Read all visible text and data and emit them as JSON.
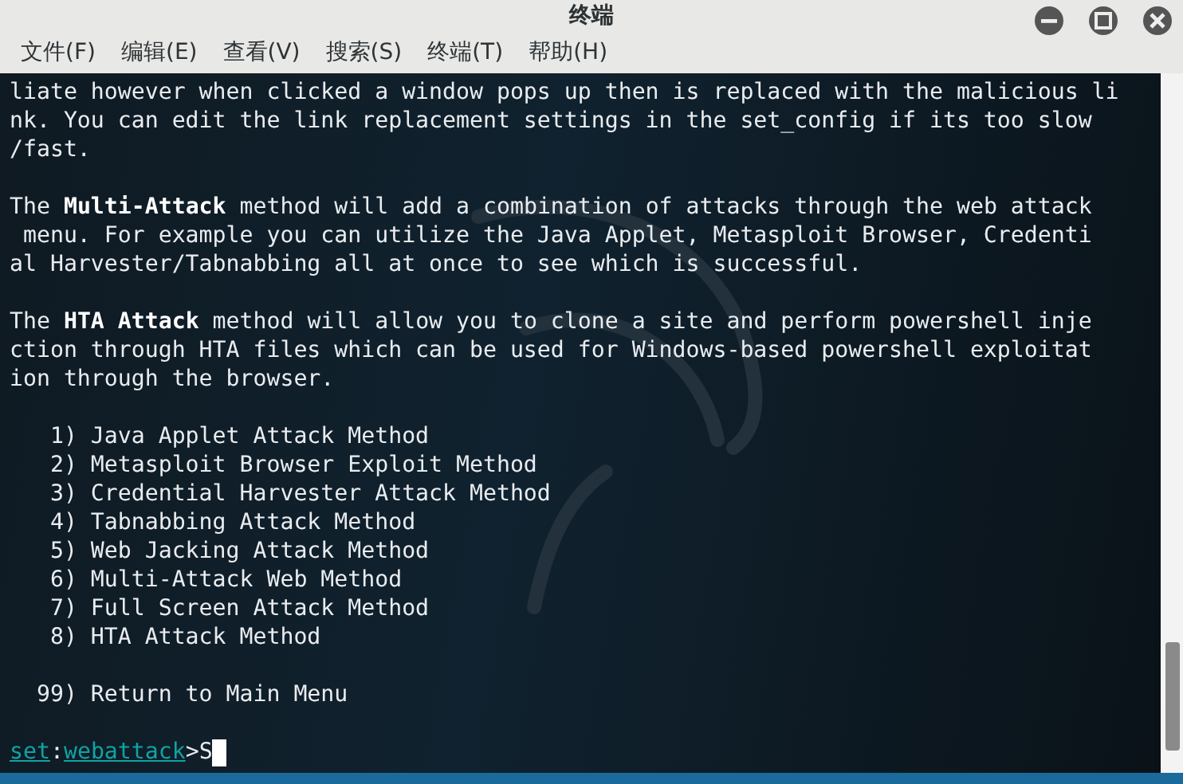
{
  "window": {
    "title": "终端"
  },
  "menu": [
    "文件(F)",
    "编辑(E)",
    "查看(V)",
    "搜索(S)",
    "终端(T)",
    "帮助(H)"
  ],
  "terminal": {
    "blocks": [
      [
        "liate however when clicked a window pops up then is replaced with the malicious li",
        "nk. You can edit the link replacement settings in the set_config if its too slow",
        "/fast."
      ],
      [
        "The **Multi-Attack** method will add a combination of attacks through the web attack",
        " menu. For example you can utilize the Java Applet, Metasploit Browser, Credenti",
        "al Harvester/Tabnabbing all at once to see which is successful."
      ],
      [
        "The **HTA Attack** method will allow you to clone a site and perform powershell inje",
        "ction through HTA files which can be used for Windows-based powershell exploitat",
        "ion through the browser."
      ],
      [
        "   1) Java Applet Attack Method",
        "   2) Metasploit Browser Exploit Method",
        "   3) Credential Harvester Attack Method",
        "   4) Tabnabbing Attack Method",
        "   5) Web Jacking Attack Method",
        "   6) Multi-Attack Web Method",
        "   7) Full Screen Attack Method",
        "   8) HTA Attack Method"
      ],
      [
        "  99) Return to Main Menu"
      ]
    ],
    "prompt": {
      "context": "set",
      "separator": ":",
      "module": "webattack",
      "arrow": ">",
      "input": "S"
    }
  }
}
